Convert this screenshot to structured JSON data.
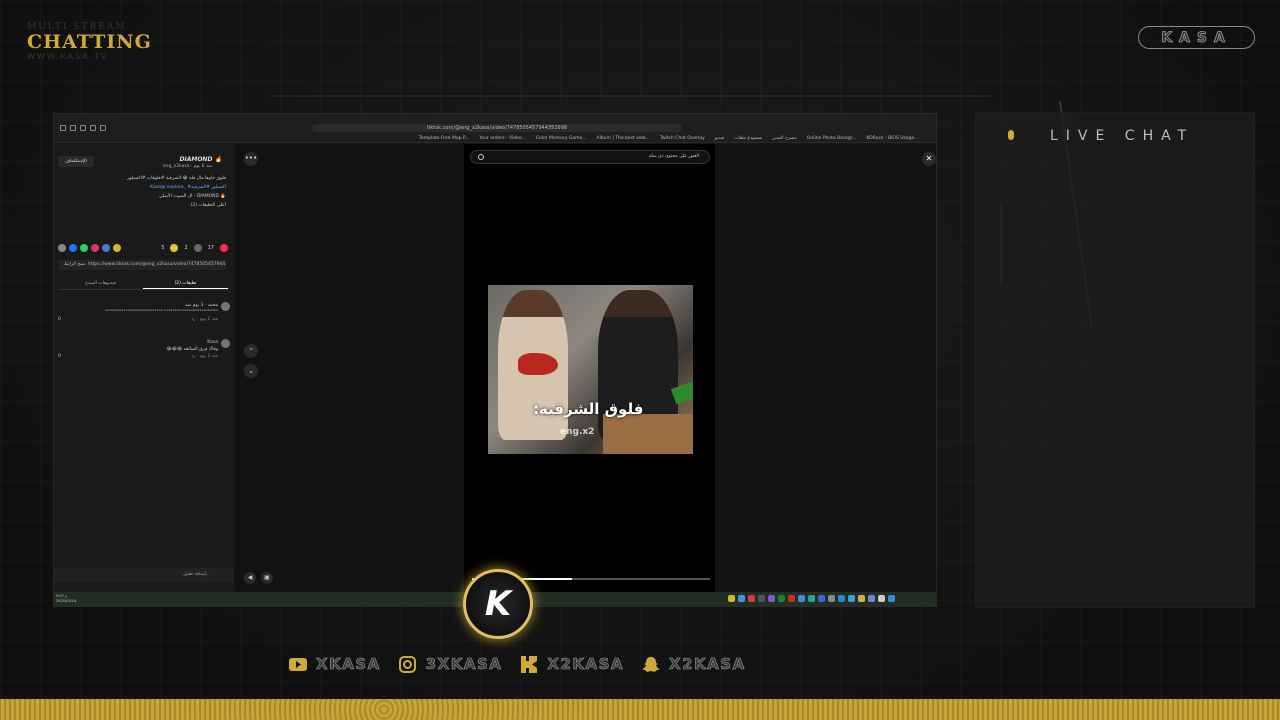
{
  "overlay": {
    "brand_top": "MULTI·STREAM",
    "brand_title": "CHATTING",
    "brand_bottom": "WWW.KASA.TV",
    "kasa_badge": "KASA",
    "live_chat_title": "LIVE CHAT",
    "logo_letter": "K",
    "socials": [
      {
        "icon": "youtube-icon",
        "label": "XKASA"
      },
      {
        "icon": "instagram-icon",
        "label": "3XKASA"
      },
      {
        "icon": "kick-icon",
        "label": "X2KASA"
      },
      {
        "icon": "snapchat-icon",
        "label": "X2KASA"
      }
    ],
    "accent_color": "#cfa93a"
  },
  "browser": {
    "url": "tiktok.com/@eng_x2kasa/video/7478505457944353998",
    "bookmarks": [
      "Template Free Map P...",
      "Your orders - Video...",
      "Color Memory Game...",
      "Album | The best web...",
      "Twitch Chat Overlay",
      "فيديو",
      "مستودع ملفات",
      "مسرح المدير",
      "Online Photo Backgr...",
      "KORock - BIOS Usage..."
    ]
  },
  "tiktok": {
    "profile_name": "DIAMOND 🔥",
    "profile_handle": "eng_x2kasa · منذ 6 يوم",
    "follow_label": "الإستكشاف",
    "caption_line1": "فلوق جاوها مال فله 😂 الشرقية #فلوقات #اكسبلور",
    "caption_tags": "Kasa@ explore_ #اكسبلور #الشرقية",
    "caption_line2": "ال الصوت الأصلي - DIAMOND 🔥",
    "caption_line3": "(2) أعلى التعليقات",
    "likes": "17",
    "comments_count": "2",
    "saves": "5",
    "link_text": "https://www.tiktok.com/@eng_x2kasa/video/7478505457944353998?_r=1&sender_device=pc&web_id=7620359559953056384",
    "copy_link": "نسخ الرابط",
    "tab_comments": "تعليقات (2)",
    "tab_creator_videos": "فيديوهات المبدع",
    "comments": [
      {
        "user": "محمد · 3 يوم منذ",
        "text": "\"\"\"\"\"\"\"\"\"\"\"\"\"\"\"\"\"\"\"\"\"\"\"\"\"\"\"\" \"\"\"\"\"\"\"\"\"\"\"\"\"\"\"\"\"\"\"\"\"\"\"\"\"\"",
        "meta": "منذ 2 يوم · رد",
        "likes": "0"
      },
      {
        "user": "Kasa",
        "text": "😂😂😂 وقاك فرق السالقه",
        "meta": "منذ 2 يوم · رد",
        "likes": "0"
      }
    ],
    "comment_placeholder": "إضافة تعليق...",
    "search_placeholder": "العثور على محتوى ذي صلة",
    "video_overlay_text": "فلوق الشرقيه:",
    "video_watermark": "eng.x2",
    "progress": 0.42
  },
  "taskbar": {
    "time": "9:07 م",
    "date": "2025/03/14"
  }
}
